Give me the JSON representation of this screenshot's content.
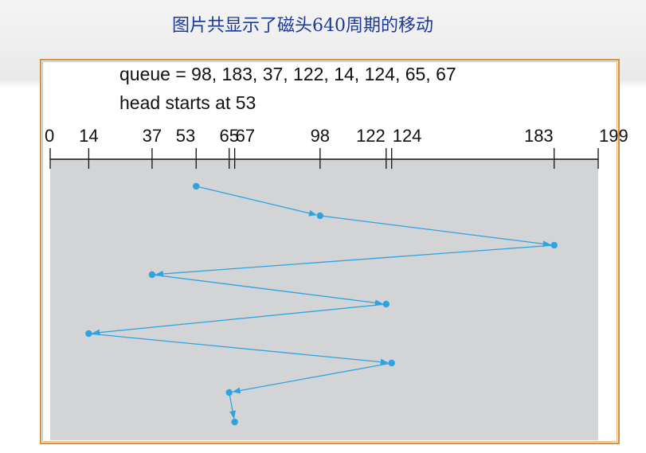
{
  "slide_title": "图片共显示了磁头640周期的移动",
  "queue_text": "queue = 98, 183, 37, 122, 14, 124, 65, 67",
  "head_text": "head starts at 53",
  "chart_data": {
    "type": "line",
    "x_ticks": [
      0,
      14,
      37,
      53,
      65,
      67,
      98,
      122,
      124,
      183,
      199
    ],
    "tick_labels": [
      "0",
      "14",
      "37",
      "53",
      "65",
      "67",
      "98",
      "122",
      "124",
      "183",
      "199"
    ],
    "xlim": [
      0,
      199
    ],
    "path": [
      53,
      98,
      183,
      37,
      122,
      14,
      124,
      65,
      67
    ],
    "colors": {
      "path": "#2ea3e0",
      "area": "#d3d4d6",
      "frame": "#d9903e",
      "title": "#1a3a9a"
    }
  }
}
